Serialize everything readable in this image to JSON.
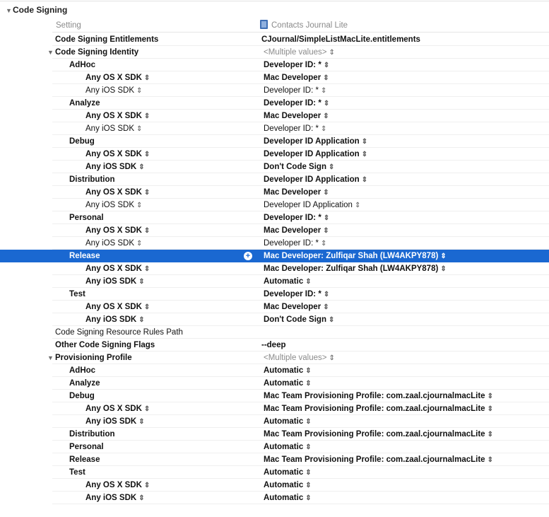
{
  "section": {
    "title": "Code Signing"
  },
  "columns": {
    "setting": "Setting",
    "target": "Contacts Journal Lite"
  },
  "rows": [
    {
      "name": "Code Signing Entitlements",
      "level": 0,
      "name_bold": true,
      "value": "CJournal/SimpleListMacLite.entitlements",
      "value_bold": true,
      "stepper": false
    },
    {
      "name": "Code Signing Identity",
      "level": 0,
      "name_bold": true,
      "disclosure": true,
      "value": "<Multiple values>",
      "value_muted": true,
      "stepper": true
    },
    {
      "name": "AdHoc",
      "level": 1,
      "name_bold": true,
      "value": "Developer ID: *",
      "value_bold": true,
      "stepper": true
    },
    {
      "name": "Any OS X SDK",
      "level": 2,
      "name_bold": true,
      "name_stepper": true,
      "value": "Mac Developer",
      "value_bold": true,
      "stepper": true
    },
    {
      "name": "Any iOS SDK",
      "level": 2,
      "name_bold": false,
      "name_stepper": true,
      "value": "Developer ID: *",
      "value_bold": false,
      "stepper": true
    },
    {
      "name": "Analyze",
      "level": 1,
      "name_bold": true,
      "value": "Developer ID: *",
      "value_bold": true,
      "stepper": true
    },
    {
      "name": "Any OS X SDK",
      "level": 2,
      "name_bold": true,
      "name_stepper": true,
      "value": "Mac Developer",
      "value_bold": true,
      "stepper": true
    },
    {
      "name": "Any iOS SDK",
      "level": 2,
      "name_bold": false,
      "name_stepper": true,
      "value": "Developer ID: *",
      "value_bold": false,
      "stepper": true
    },
    {
      "name": "Debug",
      "level": 1,
      "name_bold": true,
      "value": "Developer ID Application",
      "value_bold": true,
      "stepper": true
    },
    {
      "name": "Any OS X SDK",
      "level": 2,
      "name_bold": true,
      "name_stepper": true,
      "value": "Developer ID Application",
      "value_bold": true,
      "stepper": true
    },
    {
      "name": "Any iOS SDK",
      "level": 2,
      "name_bold": true,
      "name_stepper": true,
      "value": "Don't Code Sign",
      "value_bold": true,
      "stepper": true
    },
    {
      "name": "Distribution",
      "level": 1,
      "name_bold": true,
      "value": "Developer ID Application",
      "value_bold": true,
      "stepper": true
    },
    {
      "name": "Any OS X SDK",
      "level": 2,
      "name_bold": true,
      "name_stepper": true,
      "value": "Mac Developer",
      "value_bold": true,
      "stepper": true
    },
    {
      "name": "Any iOS SDK",
      "level": 2,
      "name_bold": false,
      "name_stepper": true,
      "value": "Developer ID Application",
      "value_bold": false,
      "stepper": true
    },
    {
      "name": "Personal",
      "level": 1,
      "name_bold": true,
      "value": "Developer ID: *",
      "value_bold": true,
      "stepper": true
    },
    {
      "name": "Any OS X SDK",
      "level": 2,
      "name_bold": true,
      "name_stepper": true,
      "value": "Mac Developer",
      "value_bold": true,
      "stepper": true
    },
    {
      "name": "Any iOS SDK",
      "level": 2,
      "name_bold": false,
      "name_stepper": true,
      "value": "Developer ID: *",
      "value_bold": false,
      "stepper": true
    },
    {
      "name": "Release",
      "level": 1,
      "name_bold": true,
      "value": "Mac Developer: Zulfiqar Shah (LW4AKPY878)",
      "value_bold": true,
      "stepper": true,
      "selected": true
    },
    {
      "name": "Any OS X SDK",
      "level": 2,
      "name_bold": true,
      "name_stepper": true,
      "value": "Mac Developer: Zulfiqar Shah (LW4AKPY878)",
      "value_bold": true,
      "stepper": true
    },
    {
      "name": "Any iOS SDK",
      "level": 2,
      "name_bold": true,
      "name_stepper": true,
      "value": "Automatic",
      "value_bold": true,
      "stepper": true
    },
    {
      "name": "Test",
      "level": 1,
      "name_bold": true,
      "value": "Developer ID: *",
      "value_bold": true,
      "stepper": true
    },
    {
      "name": "Any OS X SDK",
      "level": 2,
      "name_bold": true,
      "name_stepper": true,
      "value": "Mac Developer",
      "value_bold": true,
      "stepper": true
    },
    {
      "name": "Any iOS SDK",
      "level": 2,
      "name_bold": true,
      "name_stepper": true,
      "value": "Don't Code Sign",
      "value_bold": true,
      "stepper": true
    },
    {
      "name": "Code Signing Resource Rules Path",
      "level": 0,
      "name_bold": false,
      "value": "",
      "stepper": false
    },
    {
      "name": "Other Code Signing Flags",
      "level": 0,
      "name_bold": true,
      "value": "--deep",
      "value_bold": true,
      "stepper": false
    },
    {
      "name": "Provisioning Profile",
      "level": 0,
      "name_bold": true,
      "disclosure": true,
      "value": "<Multiple values>",
      "value_muted": true,
      "stepper": true
    },
    {
      "name": "AdHoc",
      "level": 1,
      "name_bold": true,
      "value": "Automatic",
      "value_bold": true,
      "stepper": true
    },
    {
      "name": "Analyze",
      "level": 1,
      "name_bold": true,
      "value": "Automatic",
      "value_bold": true,
      "stepper": true
    },
    {
      "name": "Debug",
      "level": 1,
      "name_bold": true,
      "value": "Mac Team Provisioning Profile: com.zaal.cjournalmacLite",
      "value_bold": true,
      "stepper": true
    },
    {
      "name": "Any OS X SDK",
      "level": 2,
      "name_bold": true,
      "name_stepper": true,
      "value": "Mac Team Provisioning Profile: com.zaal.cjournalmacLite",
      "value_bold": true,
      "stepper": true
    },
    {
      "name": "Any iOS SDK",
      "level": 2,
      "name_bold": true,
      "name_stepper": true,
      "value": "Automatic",
      "value_bold": true,
      "stepper": true
    },
    {
      "name": "Distribution",
      "level": 1,
      "name_bold": true,
      "value": "Mac Team Provisioning Profile: com.zaal.cjournalmacLite",
      "value_bold": true,
      "stepper": true
    },
    {
      "name": "Personal",
      "level": 1,
      "name_bold": true,
      "value": "Automatic",
      "value_bold": true,
      "stepper": true
    },
    {
      "name": "Release",
      "level": 1,
      "name_bold": true,
      "value": "Mac Team Provisioning Profile: com.zaal.cjournalmacLite",
      "value_bold": true,
      "stepper": true
    },
    {
      "name": "Test",
      "level": 1,
      "name_bold": true,
      "value": "Automatic",
      "value_bold": true,
      "stepper": true
    },
    {
      "name": "Any OS X SDK",
      "level": 2,
      "name_bold": true,
      "name_stepper": true,
      "value": "Automatic",
      "value_bold": true,
      "stepper": true
    },
    {
      "name": "Any iOS SDK",
      "level": 2,
      "name_bold": true,
      "name_stepper": true,
      "value": "Automatic",
      "value_bold": true,
      "stepper": true
    }
  ],
  "icons": {
    "disclosure": "disclosure-triangle-icon",
    "stepper": "stepper-icon",
    "add": "add-condition-icon",
    "project": "project-icon"
  },
  "colors": {
    "selection": "#1a68d1",
    "muted": "#8a8a8a"
  }
}
